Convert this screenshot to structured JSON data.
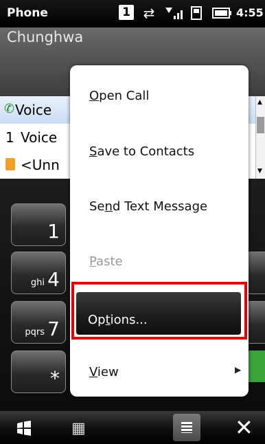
{
  "status_bar": {
    "app_title": "Phone",
    "sim_number": "1",
    "time": "4:55"
  },
  "header": {
    "carrier": "Chunghwa"
  },
  "call_list": {
    "rows": [
      {
        "label": "Voice"
      },
      {
        "index": "1",
        "label": "Voice"
      },
      {
        "label": "<Unn"
      }
    ]
  },
  "keypad": {
    "keys": [
      {
        "digit": "1",
        "letters": ""
      },
      {
        "digit": "4",
        "letters": "ghi"
      },
      {
        "digit": "7",
        "letters": "pqrs"
      },
      {
        "digit": "*",
        "letters": ""
      }
    ]
  },
  "context_menu": {
    "items": [
      {
        "label": "Open Call",
        "mnemonic": "O"
      },
      {
        "label": "Save to Contacts",
        "mnemonic": "S"
      },
      {
        "label": "Send Text Message",
        "mnemonic": "n"
      },
      {
        "label": "Paste",
        "mnemonic": "P",
        "disabled": true
      },
      {
        "label": "Options...",
        "mnemonic": "t",
        "selected": true
      },
      {
        "label": "View",
        "mnemonic": "V",
        "has_submenu": true
      }
    ]
  },
  "colors": {
    "highlight_border": "#e10000"
  },
  "bottom_bar": {
    "icons": [
      "windows-start-icon",
      "keyboard-icon",
      "menu-icon",
      "close-icon"
    ]
  }
}
